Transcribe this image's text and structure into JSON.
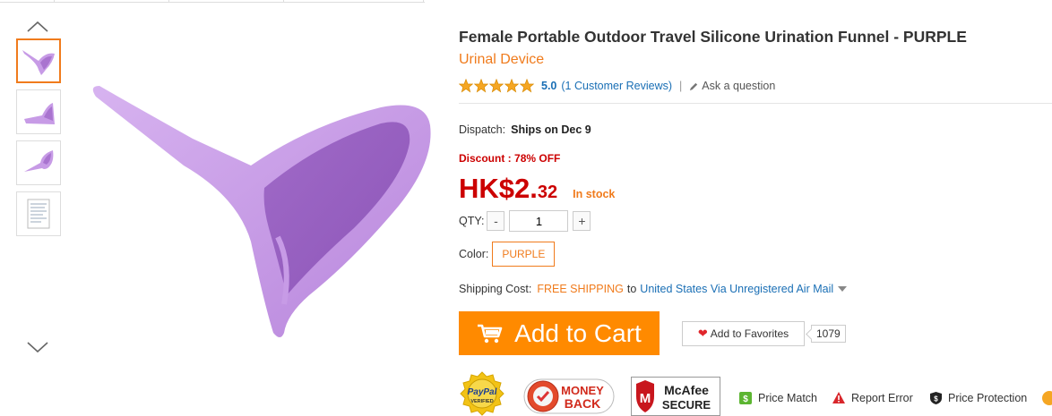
{
  "product": {
    "title": "Female Portable Outdoor Travel Silicone Urination Funnel  -  PURPLE",
    "subtitle": "Urinal Device"
  },
  "rating": {
    "stars": 5,
    "score": "5.0",
    "reviews_label": "(1 Customer Reviews)",
    "separator": "|",
    "ask_label": "Ask a question"
  },
  "dispatch": {
    "label": "Dispatch:",
    "value": "Ships on Dec 9"
  },
  "discount": {
    "label": "Discount :",
    "value": "78% OFF"
  },
  "price": {
    "main": "HK$2.",
    "cents": "32",
    "stock": "In stock"
  },
  "qty": {
    "label": "QTY:",
    "minus": "-",
    "value": "1",
    "plus": "+"
  },
  "color": {
    "label": "Color:",
    "selected": "PURPLE"
  },
  "shipping": {
    "label": "Shipping Cost:",
    "free": "FREE SHIPPING",
    "to": "to",
    "destination": "United States Via Unregistered Air Mail"
  },
  "actions": {
    "add_to_cart": "Add to Cart",
    "add_to_favorites": "Add to Favorites",
    "favorites_count": "1079"
  },
  "badges": {
    "paypal_top": "PayPal",
    "paypal_bottom": "VERIFIED",
    "money_back_1": "MONEY",
    "money_back_2": "BACK",
    "mcafee_1": "McAfee",
    "mcafee_2": "SECURE"
  },
  "links": {
    "price_match": "Price Match",
    "report_error": "Report Error",
    "price_protection": "Price Protection"
  },
  "colors": {
    "accent": "#ff8a00",
    "price_red": "#cc0000",
    "link_blue": "#1a6fb5",
    "product_purple": "#c79be6"
  }
}
